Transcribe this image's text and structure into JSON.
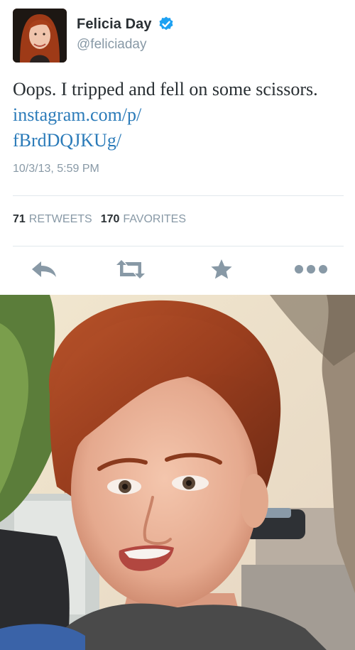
{
  "user": {
    "name": "Felicia Day",
    "handle": "@feliciaday",
    "verified": true
  },
  "tweet": {
    "text": "Oops. I tripped and fell on some scissors.",
    "link": "instagram.com/p/fBrdDQJKUg/",
    "link_line1": "instagram.com/p/",
    "link_line2": "fBrdDQJKUg/",
    "timestamp": "10/3/13, 5:59 PM"
  },
  "stats": {
    "retweets_count": "71",
    "retweets_label": "RETWEETS",
    "favorites_count": "170",
    "favorites_label": "FAVORITES"
  },
  "actions": [
    {
      "name": "reply",
      "icon": "reply-icon"
    },
    {
      "name": "retweet",
      "icon": "retweet-icon"
    },
    {
      "name": "favorite",
      "icon": "star-icon"
    },
    {
      "name": "more",
      "icon": "more-icon"
    }
  ],
  "colors": {
    "text": "#292f33",
    "secondary": "#8899a6",
    "link": "#2b7bb9",
    "verified": "#1da1f2",
    "icon": "#8899a6",
    "divider": "#e1e8ed"
  }
}
